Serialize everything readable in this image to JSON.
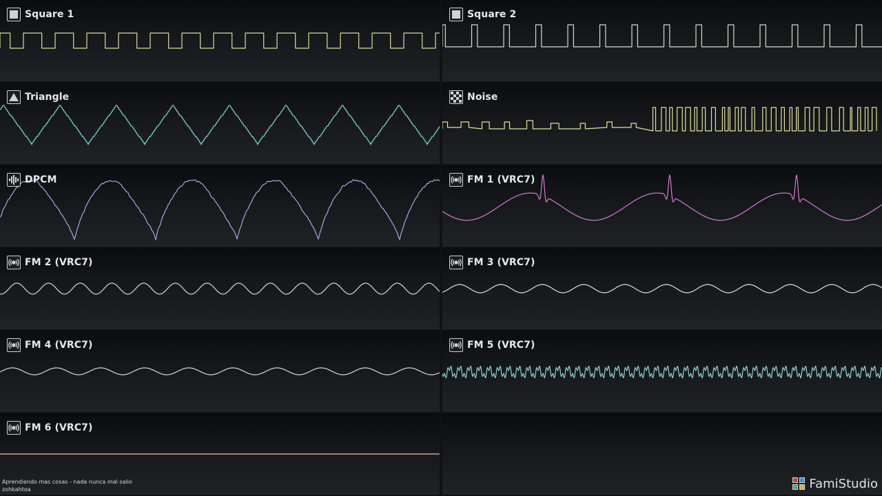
{
  "channels": [
    {
      "name": "Square 1",
      "icon": "square-icon",
      "color": "#d7e39a",
      "wave": "square",
      "period": 46,
      "duty": 0.58,
      "hi": 48,
      "lo": 70,
      "phase": 12
    },
    {
      "name": "Square 2",
      "icon": "square-icon",
      "color": "#d9ddd0",
      "wave": "square",
      "period": 46.5,
      "duty": 0.18,
      "hi": 36,
      "lo": 68,
      "phase": 4
    },
    {
      "name": "Triangle",
      "icon": "triangle-icon",
      "color": "#6fcfc2",
      "wave": "triangle",
      "period": 82,
      "hi": 153,
      "lo": 209,
      "phase": 36
    },
    {
      "name": "Noise",
      "icon": "noise-icon",
      "color": "#e4e59b",
      "wave": "noise",
      "base": 187
    },
    {
      "name": "DPCM",
      "icon": "dpcm-icon",
      "color": "#a9a6e6",
      "wave": "dpcm",
      "period": 118,
      "hi": 262,
      "lo": 348,
      "phase": 10
    },
    {
      "name": "FM 1 (VRC7)",
      "icon": "fm-icon",
      "color": "#d87bd8",
      "wave": "fm1",
      "period": 184,
      "mid": 300,
      "phase": 130
    },
    {
      "name": "FM 2 (VRC7)",
      "icon": "fm-icon",
      "color": "#cde0dc",
      "wave": "sine",
      "period": 46,
      "mid": 419,
      "amp": 8,
      "phase": 10
    },
    {
      "name": "FM 3 (VRC7)",
      "icon": "fm-icon",
      "color": "#dfe8d6",
      "wave": "sine",
      "period": 60,
      "mid": 419,
      "amp": 6,
      "phase": 20
    },
    {
      "name": "FM 4 (VRC7)",
      "icon": "fm-icon",
      "color": "#cfe0d6",
      "wave": "sine",
      "period": 64,
      "mid": 539,
      "amp": 5,
      "phase": 30
    },
    {
      "name": "FM 5 (VRC7)",
      "icon": "fm-icon",
      "color": "#8fd6d2",
      "wave": "buzz",
      "period": 14.3,
      "mid": 540,
      "amp": 9,
      "phase": 0
    },
    {
      "name": "FM 6 (VRC7)",
      "icon": "fm-icon",
      "color": "#e8c7a0",
      "wave": "flat",
      "mid": 659
    }
  ],
  "footer": {
    "song": "Aprendiendo mas cosas - nada nunca mal salio",
    "author": "zohkahtoa"
  },
  "brand": "FamiStudio"
}
